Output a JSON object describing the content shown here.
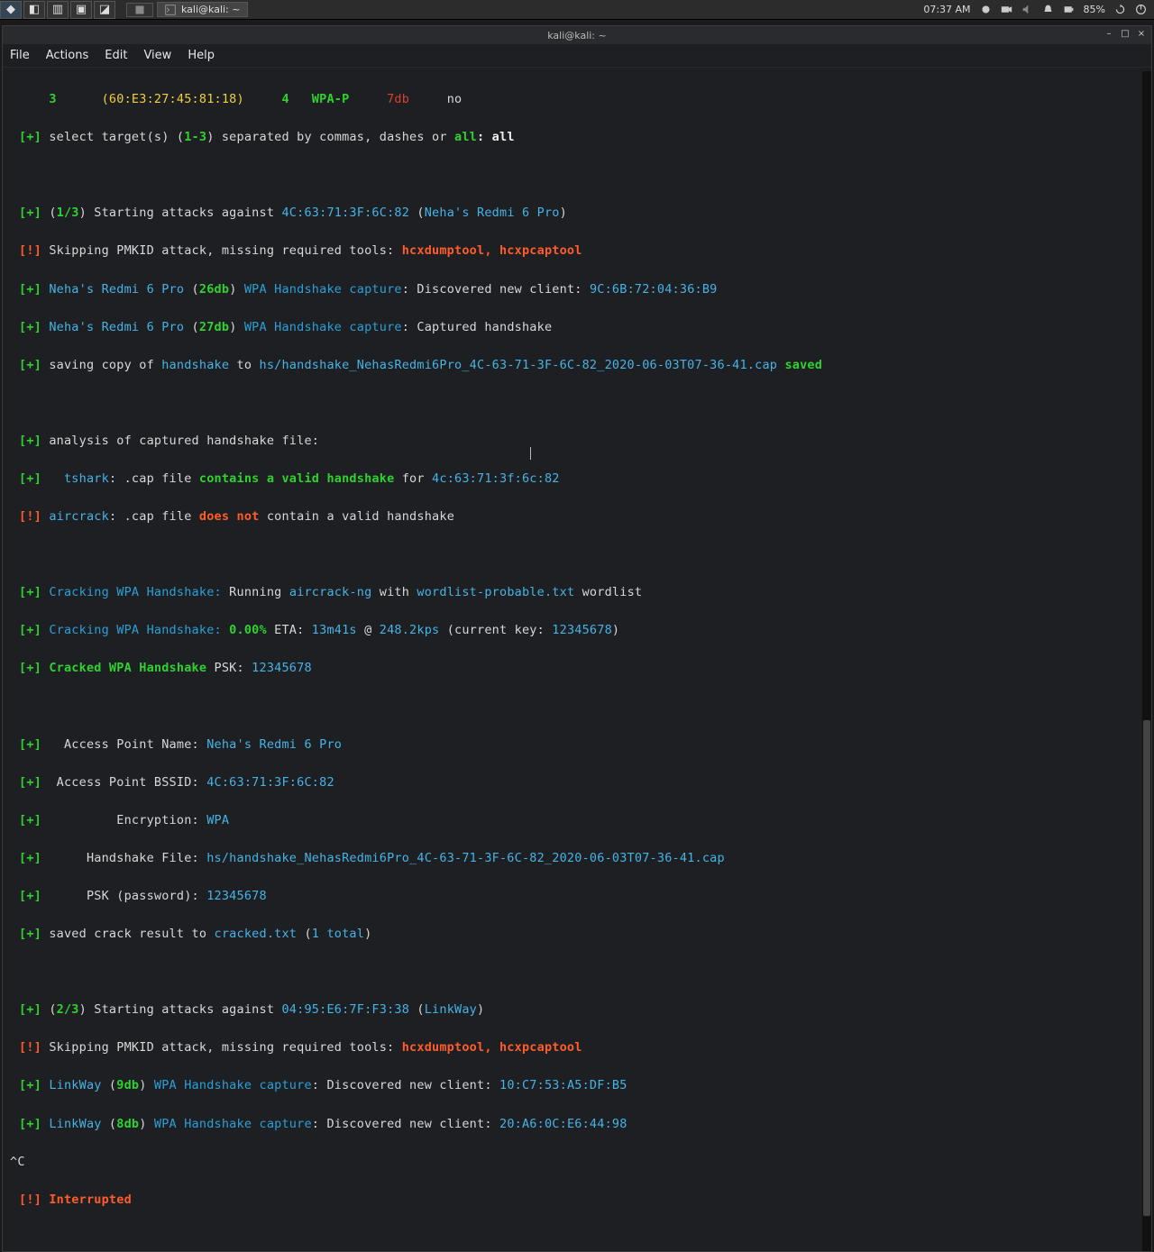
{
  "panel": {
    "task_title": "kali@kali: ~",
    "clock": "07:37 AM",
    "battery": "85%"
  },
  "window": {
    "title": "kali@kali: ~"
  },
  "menu": {
    "file": "File",
    "actions": "Actions",
    "edit": "Edit",
    "view": "View",
    "help": "Help"
  },
  "t": {
    "line00_num": "3",
    "line00_mac": "(60:E3:27:45:81:18)",
    "line00_n": "4",
    "line00_wpa": "WPA-P",
    "line00_db": "7db",
    "line00_no": "no",
    "line01_a": "select target(s) (",
    "line01_b": "1-3",
    "line01_c": ") separated by commas, dashes or ",
    "line01_d": "all",
    "line01_e": ": all",
    "line03_prefix": "(",
    "line03_count": "1/3",
    "line03_txt": ") Starting attacks against ",
    "line03_mac": "4C:63:71:3F:6C:82",
    "line03_open": " (",
    "line03_essid": "Neha's Redmi 6 Pro",
    "line03_close": ")",
    "line04_txt": "Skipping PMKID attack, missing required tools: ",
    "line04_tools": "hcxdumptool, hcxpcaptool",
    "line05_essid": "Neha's Redmi 6 Pro",
    "line05_open": " (",
    "line05_db": "26db",
    "line05_close": ") ",
    "line05_cap": "WPA Handshake capture",
    "line05_txt": ": Discovered new client: ",
    "line05_mac": "9C:6B:72:04:36:B9",
    "line06_essid": "Neha's Redmi 6 Pro",
    "line06_open": " (",
    "line06_db": "27db",
    "line06_close": ") ",
    "line06_cap": "WPA Handshake capture",
    "line06_txt": ": Captured handshake",
    "line07_a": "saving copy of ",
    "line07_hs": "handshake",
    "line07_b": " to ",
    "line07_file": "hs/handshake_NehasRedmi6Pro_4C-63-71-3F-6C-82_2020-06-03T07-36-41.cap",
    "line07_saved": " saved",
    "line09_txt": "analysis of captured handshake file:",
    "line10_tool": "tshark",
    "line10_a": ": .cap file ",
    "line10_contains": "contains a valid handshake",
    "line10_b": " for ",
    "line10_mac": "4c:63:71:3f:6c:82",
    "line11_tool": "aircrack",
    "line11_a": ": .cap file ",
    "line11_doesnot": "does not",
    "line11_b": " contain a valid handshake",
    "line13_label": "Cracking WPA Handshake:",
    "line13_a": " Running ",
    "line13_tool": "aircrack-ng",
    "line13_b": " with ",
    "line13_wl": "wordlist-probable.txt",
    "line13_c": " wordlist",
    "line14_label": "Cracking WPA Handshake:",
    "line14_pct": " 0.00%",
    "line14_a": " ETA: ",
    "line14_eta": "13m41s",
    "line14_b": " @ ",
    "line14_rate": "248.2kps",
    "line14_c": " (current key: ",
    "line14_key": "12345678",
    "line14_d": ")",
    "line15_label": "Cracked WPA Handshake",
    "line15_a": " PSK: ",
    "line15_psk": "12345678",
    "line17_label": "  Access Point Name: ",
    "line17_val": "Neha's Redmi 6 Pro",
    "line18_label": " Access Point BSSID: ",
    "line18_val": "4C:63:71:3F:6C:82",
    "line19_label": "         Encryption: ",
    "line19_val": "WPA",
    "line20_label": "     Handshake File: ",
    "line20_val": "hs/handshake_NehasRedmi6Pro_4C-63-71-3F-6C-82_2020-06-03T07-36-41.cap",
    "line21_label": "     PSK (password): ",
    "line21_val": "12345678",
    "line22_a": "saved crack result to ",
    "line22_file": "cracked.txt",
    "line22_b": " (",
    "line22_total": "1 total",
    "line22_c": ")",
    "line24_prefix": "(",
    "line24_count": "2/3",
    "line24_txt": ") Starting attacks against ",
    "line24_mac": "04:95:E6:7F:F3:38",
    "line24_open": " (",
    "line24_essid": "LinkWay",
    "line24_close": ")",
    "line25_txt": "Skipping PMKID attack, missing required tools: ",
    "line25_tools": "hcxdumptool, hcxpcaptool",
    "line26_essid": "LinkWay",
    "line26_open": " (",
    "line26_db": "9db",
    "line26_close": ") ",
    "line26_cap": "WPA Handshake capture",
    "line26_txt": ": Discovered new client: ",
    "line26_mac": "10:C7:53:A5:DF:B5",
    "line27_essid": "LinkWay",
    "line27_open": " (",
    "line27_db": "8db",
    "line27_close": ") ",
    "line27_cap": "WPA Handshake capture",
    "line27_txt": ": Discovered new client: ",
    "line27_mac": "20:A6:0C:E6:44:98",
    "line28": "^C",
    "line29": "Interrupted",
    "br_plus_open": "[",
    "br_plus_sym": "+",
    "br_plus_close": "] ",
    "br_excl_open": "[",
    "br_excl_sym": "!",
    "br_excl_close": "] "
  }
}
